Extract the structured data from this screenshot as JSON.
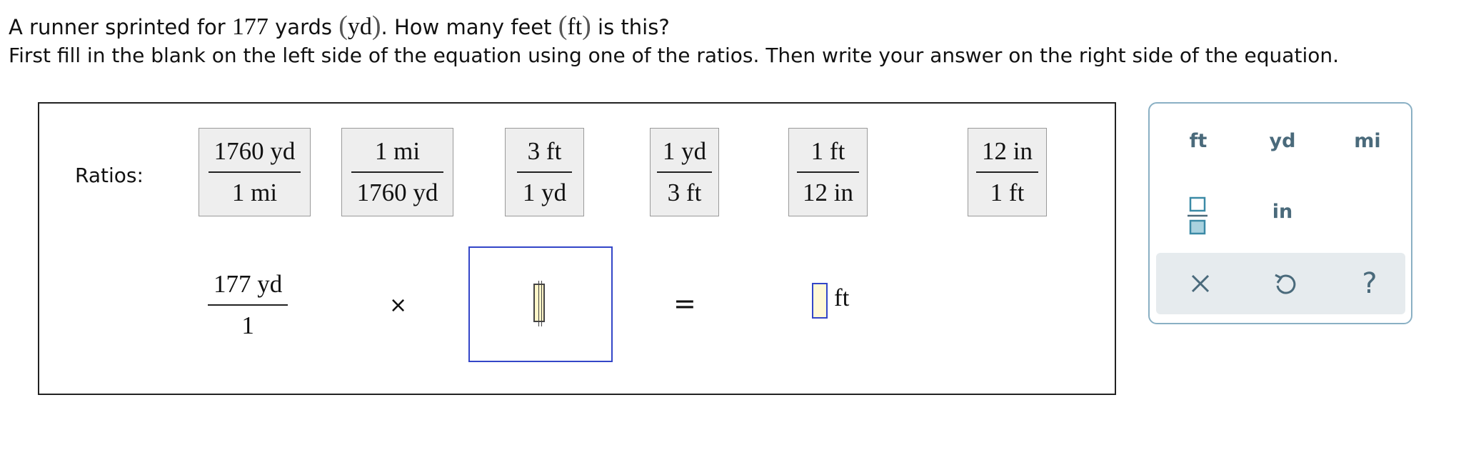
{
  "question": {
    "t1": "A runner sprinted for ",
    "yards_value": "177",
    "t2": " yards ",
    "yd_open": "(",
    "yd_abbr": "yd",
    "yd_close": ")",
    "t3": ". How many feet ",
    "ft_open": "(",
    "ft_abbr": "ft",
    "ft_close": ")",
    "t4": " is this?"
  },
  "instructions": "First fill in the blank on the left side of the equation using one of the ratios. Then write your answer on the right side of the equation.",
  "ratios_label": "Ratios:",
  "ratios": [
    {
      "num": "1760 yd",
      "den": "1 mi"
    },
    {
      "num": "1 mi",
      "den": "1760 yd"
    },
    {
      "num": "3 ft",
      "den": "1 yd"
    },
    {
      "num": "1 yd",
      "den": "3 ft"
    },
    {
      "num": "1 ft",
      "den": "12 in"
    },
    {
      "num": "12 in",
      "den": "1 ft"
    }
  ],
  "equation": {
    "given_num": "177 yd",
    "given_den": "1",
    "times": "×",
    "equals": "=",
    "answer_value": "",
    "answer_unit": "ft"
  },
  "palette": {
    "units": [
      "ft",
      "yd",
      "mi",
      "in"
    ],
    "icons": [
      "fraction-icon",
      "clear-icon",
      "undo-icon",
      "help-icon"
    ],
    "help": "?",
    "accent_color": "#4a6a7b",
    "input_border_color": "#3346c8"
  }
}
